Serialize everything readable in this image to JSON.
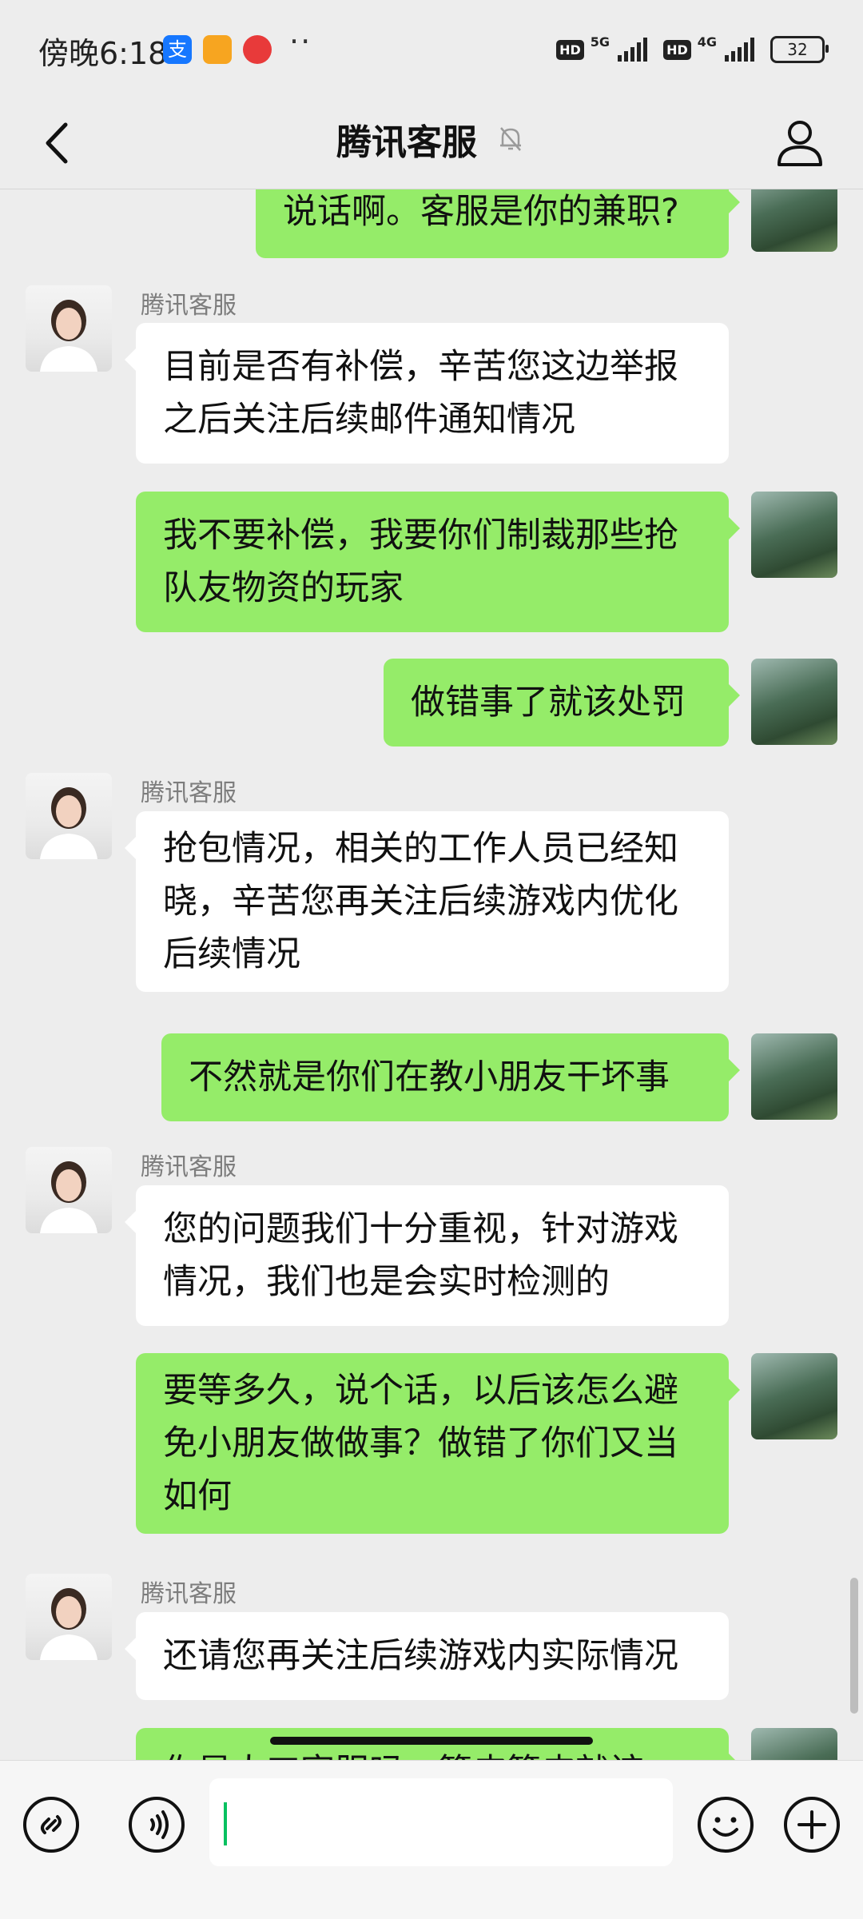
{
  "status_bar": {
    "time": "傍晚6:18",
    "dots": "··",
    "hd1": "HD",
    "net1": "5G",
    "hd2": "HD",
    "net2": "4G",
    "battery": "32"
  },
  "header": {
    "title": "腾讯客服"
  },
  "chat": {
    "sender_name": "腾讯客服",
    "messages": [
      {
        "from": "me",
        "text": "说话啊。客服是你的兼职?"
      },
      {
        "from": "cs",
        "name": "腾讯客服",
        "text": "目前是否有补偿，辛苦您这边举报之后关注后续邮件通知情况"
      },
      {
        "from": "me",
        "text": "我不要补偿，我要你们制裁那些抢队友物资的玩家"
      },
      {
        "from": "me",
        "text": "做错事了就该处罚"
      },
      {
        "from": "cs",
        "name": "腾讯客服",
        "text": "抢包情况，相关的工作人员已经知晓，辛苦您再关注后续游戏内优化后续情况"
      },
      {
        "from": "me",
        "text": "不然就是你们在教小朋友干坏事"
      },
      {
        "from": "cs",
        "name": "腾讯客服",
        "text": "您的问题我们十分重视，针对游戏情况，我们也是会实时检测的"
      },
      {
        "from": "me",
        "text": "要等多久，说个话，以后该怎么避免小朋友做做事？做错了你们又当如何"
      },
      {
        "from": "cs",
        "name": "腾讯客服",
        "text": "还请您再关注后续游戏内实际情况"
      },
      {
        "from": "me",
        "text": "你是人工客服吗，篮皮篮皮就该..."
      }
    ]
  },
  "input_bar": {
    "text_value": "",
    "accent": "#07c160"
  },
  "colors": {
    "bubble_me": "#95ec69",
    "bubble_cs": "#ffffff",
    "background": "#ededed"
  }
}
